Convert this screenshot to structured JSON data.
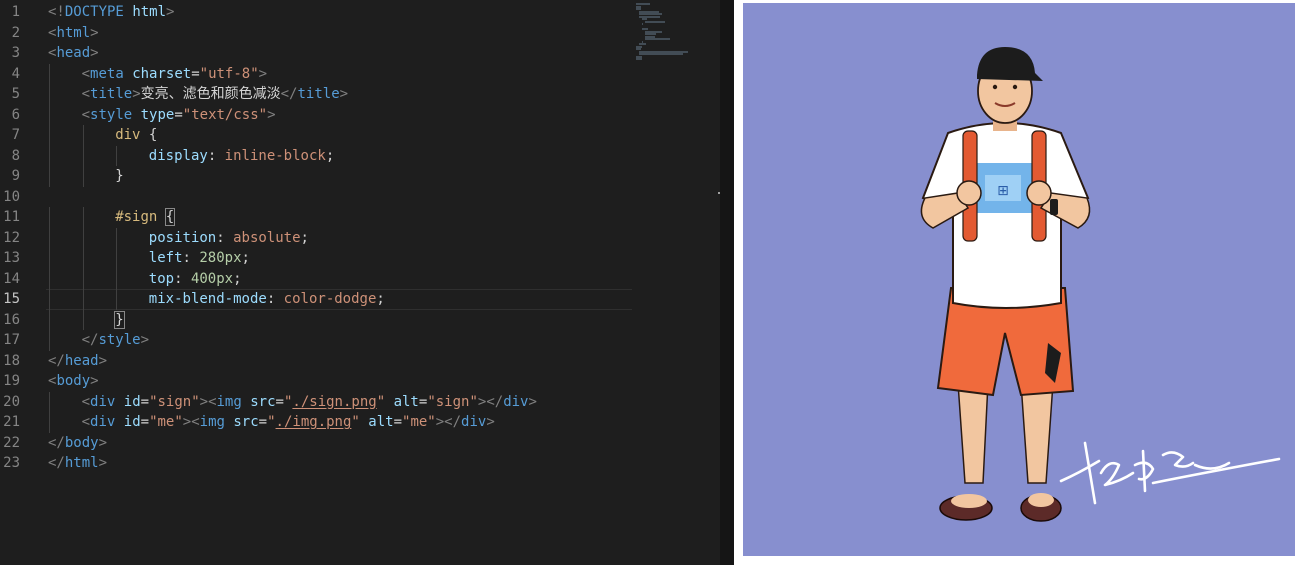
{
  "editor": {
    "active_line": 15,
    "line_numbers": [
      "1",
      "2",
      "3",
      "4",
      "5",
      "6",
      "7",
      "8",
      "9",
      "10",
      "11",
      "12",
      "13",
      "14",
      "15",
      "16",
      "17",
      "18",
      "19",
      "20",
      "21",
      "22",
      "23"
    ],
    "colors": {
      "background": "#1e1e1e",
      "tag": "#569cd6",
      "attribute": "#9cdcfe",
      "string": "#ce9178",
      "selector": "#d7ba7d",
      "number": "#b5cea8"
    },
    "lines": [
      {
        "indent": 0,
        "tokens": [
          [
            "punc",
            "<!"
          ],
          [
            "tag",
            "DOCTYPE"
          ],
          [
            "txt",
            " "
          ],
          [
            "attr",
            "html"
          ],
          [
            "punc",
            ">"
          ]
        ]
      },
      {
        "indent": 0,
        "tokens": [
          [
            "punc",
            "<"
          ],
          [
            "tag",
            "html"
          ],
          [
            "punc",
            ">"
          ]
        ]
      },
      {
        "indent": 0,
        "tokens": [
          [
            "punc",
            "<"
          ],
          [
            "tag",
            "head"
          ],
          [
            "punc",
            ">"
          ]
        ]
      },
      {
        "indent": 1,
        "tokens": [
          [
            "punc",
            "<"
          ],
          [
            "tag",
            "meta"
          ],
          [
            "txt",
            " "
          ],
          [
            "attr",
            "charset"
          ],
          [
            "txt",
            "="
          ],
          [
            "str",
            "\"utf-8\""
          ],
          [
            "punc",
            ">"
          ]
        ]
      },
      {
        "indent": 1,
        "tokens": [
          [
            "punc",
            "<"
          ],
          [
            "tag",
            "title"
          ],
          [
            "punc",
            ">"
          ],
          [
            "txt",
            "变亮、滤色和颜色减淡"
          ],
          [
            "punc",
            "</"
          ],
          [
            "tag",
            "title"
          ],
          [
            "punc",
            ">"
          ]
        ]
      },
      {
        "indent": 1,
        "tokens": [
          [
            "punc",
            "<"
          ],
          [
            "tag",
            "style"
          ],
          [
            "txt",
            " "
          ],
          [
            "attr",
            "type"
          ],
          [
            "txt",
            "="
          ],
          [
            "str",
            "\"text/css\""
          ],
          [
            "punc",
            ">"
          ]
        ]
      },
      {
        "indent": 2,
        "tokens": [
          [
            "sel",
            "div"
          ],
          [
            "txt",
            " {"
          ]
        ]
      },
      {
        "indent": 3,
        "tokens": [
          [
            "prop",
            "display"
          ],
          [
            "txt",
            ": "
          ],
          [
            "val",
            "inline-block"
          ],
          [
            "txt",
            ";"
          ]
        ]
      },
      {
        "indent": 2,
        "tokens": [
          [
            "txt",
            "}"
          ]
        ]
      },
      {
        "indent": 0,
        "tokens": []
      },
      {
        "indent": 2,
        "tokens": [
          [
            "sel",
            "#sign"
          ],
          [
            "txt",
            " "
          ],
          [
            "bm",
            "{"
          ]
        ]
      },
      {
        "indent": 3,
        "tokens": [
          [
            "prop",
            "position"
          ],
          [
            "txt",
            ": "
          ],
          [
            "val",
            "absolute"
          ],
          [
            "txt",
            ";"
          ]
        ]
      },
      {
        "indent": 3,
        "tokens": [
          [
            "prop",
            "left"
          ],
          [
            "txt",
            ": "
          ],
          [
            "num",
            "280px"
          ],
          [
            "txt",
            ";"
          ]
        ]
      },
      {
        "indent": 3,
        "tokens": [
          [
            "prop",
            "top"
          ],
          [
            "txt",
            ": "
          ],
          [
            "num",
            "400px"
          ],
          [
            "txt",
            ";"
          ]
        ]
      },
      {
        "indent": 3,
        "tokens": [
          [
            "prop",
            "mix-blend-mode"
          ],
          [
            "txt",
            ": "
          ],
          [
            "val",
            "color-dodge"
          ],
          [
            "txt",
            ";"
          ]
        ]
      },
      {
        "indent": 2,
        "tokens": [
          [
            "bm",
            "}"
          ]
        ]
      },
      {
        "indent": 1,
        "tokens": [
          [
            "punc",
            "</"
          ],
          [
            "tag",
            "style"
          ],
          [
            "punc",
            ">"
          ]
        ]
      },
      {
        "indent": 0,
        "tokens": [
          [
            "punc",
            "</"
          ],
          [
            "tag",
            "head"
          ],
          [
            "punc",
            ">"
          ]
        ]
      },
      {
        "indent": 0,
        "tokens": [
          [
            "punc",
            "<"
          ],
          [
            "tag",
            "body"
          ],
          [
            "punc",
            ">"
          ]
        ]
      },
      {
        "indent": 1,
        "tokens": [
          [
            "punc",
            "<"
          ],
          [
            "tag",
            "div"
          ],
          [
            "txt",
            " "
          ],
          [
            "attr",
            "id"
          ],
          [
            "txt",
            "="
          ],
          [
            "str",
            "\"sign\""
          ],
          [
            "punc",
            "><"
          ],
          [
            "tag",
            "img"
          ],
          [
            "txt",
            " "
          ],
          [
            "attr",
            "src"
          ],
          [
            "txt",
            "="
          ],
          [
            "str",
            "\""
          ],
          [
            "link",
            "./sign.png"
          ],
          [
            "str",
            "\""
          ],
          [
            "txt",
            " "
          ],
          [
            "attr",
            "alt"
          ],
          [
            "txt",
            "="
          ],
          [
            "str",
            "\"sign\""
          ],
          [
            "punc",
            "></"
          ],
          [
            "tag",
            "div"
          ],
          [
            "punc",
            ">"
          ]
        ]
      },
      {
        "indent": 1,
        "tokens": [
          [
            "punc",
            "<"
          ],
          [
            "tag",
            "div"
          ],
          [
            "txt",
            " "
          ],
          [
            "attr",
            "id"
          ],
          [
            "txt",
            "="
          ],
          [
            "str",
            "\"me\""
          ],
          [
            "punc",
            "><"
          ],
          [
            "tag",
            "img"
          ],
          [
            "txt",
            " "
          ],
          [
            "attr",
            "src"
          ],
          [
            "txt",
            "="
          ],
          [
            "str",
            "\""
          ],
          [
            "link",
            "./img.png"
          ],
          [
            "str",
            "\""
          ],
          [
            "txt",
            " "
          ],
          [
            "attr",
            "alt"
          ],
          [
            "txt",
            "="
          ],
          [
            "str",
            "\"me\""
          ],
          [
            "punc",
            "></"
          ],
          [
            "tag",
            "div"
          ],
          [
            "punc",
            ">"
          ]
        ]
      },
      {
        "indent": 0,
        "tokens": [
          [
            "punc",
            "</"
          ],
          [
            "tag",
            "body"
          ],
          [
            "punc",
            ">"
          ]
        ]
      },
      {
        "indent": 0,
        "tokens": [
          [
            "punc",
            "</"
          ],
          [
            "tag",
            "html"
          ],
          [
            "punc",
            ">"
          ]
        ]
      }
    ]
  },
  "preview": {
    "canvas_color": "#878fcf",
    "shirt_color": "#ffffff",
    "shorts_color": "#f06a3c",
    "backpack_color": "#e35a32",
    "skin_color": "#f2c6a0",
    "cap_color": "#1c1c1c",
    "signature_color": "#ffffff"
  }
}
